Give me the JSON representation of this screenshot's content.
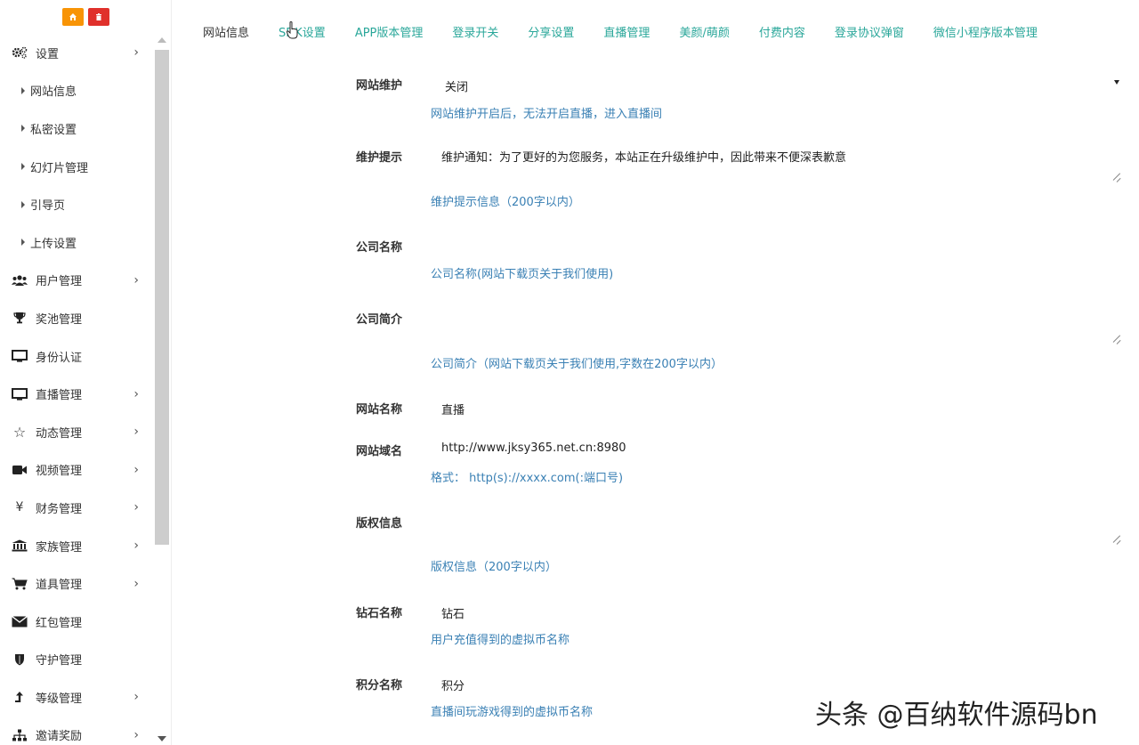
{
  "sidebar": {
    "top_buttons": [
      {
        "icon": "home-icon",
        "color": "#f89406"
      },
      {
        "icon": "trash-icon",
        "color": "#e0302b"
      }
    ],
    "items": [
      {
        "label": "设置",
        "icon": "gears-icon",
        "has_chevron": true,
        "sub": false
      },
      {
        "label": "网站信息",
        "sub": true
      },
      {
        "label": "私密设置",
        "sub": true
      },
      {
        "label": "幻灯片管理",
        "sub": true
      },
      {
        "label": "引导页",
        "sub": true
      },
      {
        "label": "上传设置",
        "sub": true
      },
      {
        "label": "用户管理",
        "icon": "users-icon",
        "has_chevron": true,
        "sub": false
      },
      {
        "label": "奖池管理",
        "icon": "trophy-icon",
        "has_chevron": false,
        "sub": false
      },
      {
        "label": "身份认证",
        "icon": "monitor-icon",
        "has_chevron": false,
        "sub": false
      },
      {
        "label": "直播管理",
        "icon": "monitor-icon",
        "has_chevron": true,
        "sub": false
      },
      {
        "label": "动态管理",
        "icon": "star-icon",
        "has_chevron": true,
        "sub": false
      },
      {
        "label": "视频管理",
        "icon": "video-camera-icon",
        "has_chevron": true,
        "sub": false
      },
      {
        "label": "财务管理",
        "icon": "yen-icon",
        "has_chevron": true,
        "sub": false
      },
      {
        "label": "家族管理",
        "icon": "bank-icon",
        "has_chevron": true,
        "sub": false
      },
      {
        "label": "道具管理",
        "icon": "cart-icon",
        "has_chevron": true,
        "sub": false
      },
      {
        "label": "红包管理",
        "icon": "envelope-icon",
        "has_chevron": false,
        "sub": false
      },
      {
        "label": "守护管理",
        "icon": "shield-icon",
        "has_chevron": false,
        "sub": false
      },
      {
        "label": "等级管理",
        "icon": "level-up-icon",
        "has_chevron": true,
        "sub": false
      },
      {
        "label": "邀请奖励",
        "icon": "sitemap-icon",
        "has_chevron": true,
        "sub": false
      }
    ]
  },
  "tabs": [
    {
      "label": "网站信息",
      "active": true
    },
    {
      "label": "SDK设置",
      "active": false
    },
    {
      "label": "APP版本管理",
      "active": false
    },
    {
      "label": "登录开关",
      "active": false
    },
    {
      "label": "分享设置",
      "active": false
    },
    {
      "label": "直播管理",
      "active": false
    },
    {
      "label": "美颜/萌颜",
      "active": false
    },
    {
      "label": "付费内容",
      "active": false
    },
    {
      "label": "登录协议弹窗",
      "active": false
    },
    {
      "label": "微信小程序版本管理",
      "active": false
    }
  ],
  "form": {
    "maintenance": {
      "label": "网站维护",
      "value": "关闭",
      "help": "网站维护开启后，无法开启直播，进入直播间"
    },
    "maintenance_tip": {
      "label": "维护提示",
      "value": "维护通知：为了更好的为您服务，本站正在升级维护中，因此带来不便深表歉意",
      "help": "维护提示信息（200字以内）"
    },
    "company_name": {
      "label": "公司名称",
      "value": "",
      "help": "公司名称(网站下载页关于我们使用)"
    },
    "company_intro": {
      "label": "公司简介",
      "value": "",
      "help": "公司简介（网站下载页关于我们使用,字数在200字以内）"
    },
    "site_name": {
      "label": "网站名称",
      "value": "直播",
      "help": ""
    },
    "site_domain": {
      "label": "网站域名",
      "value": "http://www.jksy365.net.cn:8980",
      "help": "格式： http(s)://xxxx.com(:端口号)"
    },
    "copyright": {
      "label": "版权信息",
      "value": "",
      "help": "版权信息（200字以内）"
    },
    "diamond_name": {
      "label": "钻石名称",
      "value": "钻石",
      "help": "用户充值得到的虚拟币名称"
    },
    "points_name": {
      "label": "积分名称",
      "value": "积分",
      "help": "直播间玩游戏得到的虚拟币名称"
    }
  },
  "watermark": "头条 @百纳软件源码bn",
  "colors": {
    "tab": "#2aa79a",
    "help": "#3a80b4",
    "home_btn": "#f89406",
    "trash_btn": "#e0302b"
  }
}
